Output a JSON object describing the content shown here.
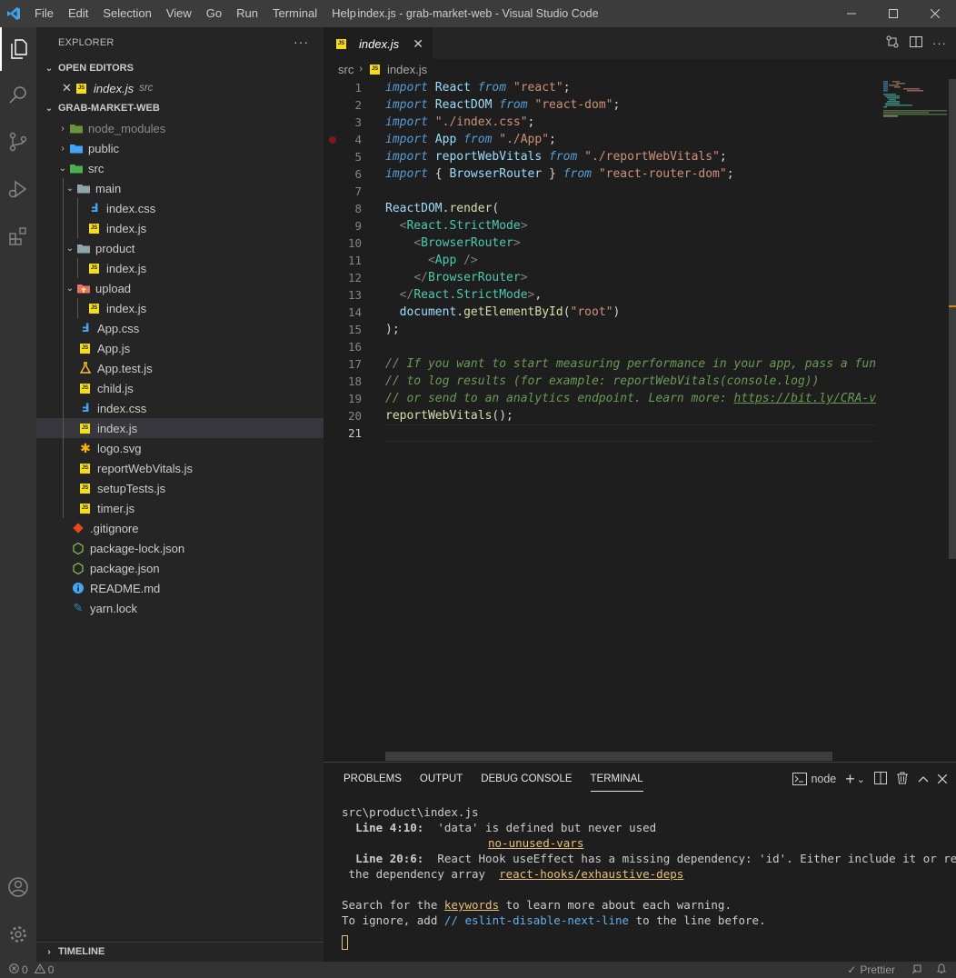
{
  "titlebar": {
    "menu": [
      "File",
      "Edit",
      "Selection",
      "View",
      "Go",
      "Run",
      "Terminal",
      "Help"
    ],
    "title": "index.js - grab-market-web - Visual Studio Code"
  },
  "sidebar": {
    "title": "EXPLORER",
    "open_editors_label": "OPEN EDITORS",
    "open_file": "index.js",
    "open_file_dir": "src",
    "project_label": "GRAB-MARKET-WEB",
    "tree": {
      "node_modules": "node_modules",
      "public": "public",
      "src": "src",
      "main": "main",
      "main_css": "index.css",
      "main_js": "index.js",
      "product": "product",
      "product_js": "index.js",
      "upload": "upload",
      "upload_js": "index.js",
      "app_css": "App.css",
      "app_js": "App.js",
      "app_test": "App.test.js",
      "child": "child.js",
      "index_css": "index.css",
      "index_js": "index.js",
      "logo": "logo.svg",
      "report": "reportWebVitals.js",
      "setup": "setupTests.js",
      "timer": "timer.js",
      "gitignore": ".gitignore",
      "pkg_lock": "package-lock.json",
      "pkg": "package.json",
      "readme": "README.md",
      "yarn": "yarn.lock"
    },
    "timeline_label": "TIMELINE"
  },
  "editor": {
    "tab_label": "index.js",
    "breadcrumb_dir": "src",
    "breadcrumb_file": "index.js",
    "line_numbers": [
      "1",
      "2",
      "3",
      "4",
      "5",
      "6",
      "7",
      "8",
      "9",
      "10",
      "11",
      "12",
      "13",
      "14",
      "15",
      "16",
      "17",
      "18",
      "19",
      "20",
      "21"
    ]
  },
  "panel": {
    "tabs": [
      "PROBLEMS",
      "OUTPUT",
      "DEBUG CONSOLE",
      "TERMINAL"
    ],
    "shell": "node",
    "terminal": {
      "file": "src\\product\\index.js",
      "w1_loc": "Line 4:10:",
      "w1_msg": "  'data' is defined but never used",
      "w1_rule": "no-unused-vars",
      "w2_loc": "Line 20:6:",
      "w2_msg": "  React Hook useEffect has a missing dependency: 'id'. Either include it or remove",
      "w2_cont": " the dependency array  ",
      "w2_rule": "react-hooks/exhaustive-deps",
      "search_pre": "Search for the ",
      "search_kw": "keywords",
      "search_post": " to learn more about each warning.",
      "ignore_pre": "To ignore, add ",
      "ignore_kw": "// eslint-disable-next-line",
      "ignore_post": " to the line before."
    }
  },
  "statusbar": {
    "errors": "0",
    "warnings": "0",
    "prettier": "Prettier"
  }
}
